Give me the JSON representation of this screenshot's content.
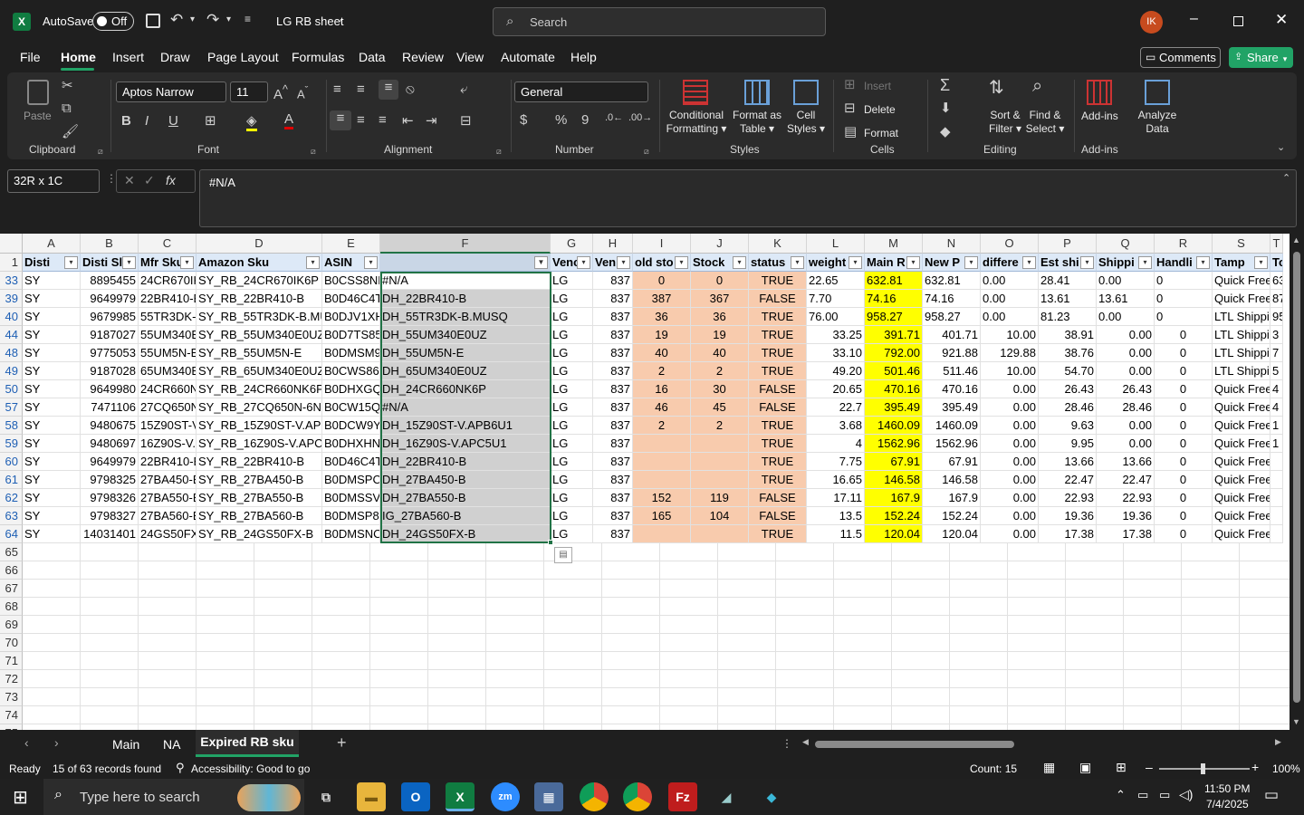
{
  "title_bar": {
    "autosave_label": "AutoSave",
    "autosave_state": "Off",
    "doc_title": "LG RB sheet",
    "search_placeholder": "Search",
    "avatar_initials": "IK"
  },
  "menu": [
    "File",
    "Home",
    "Insert",
    "Draw",
    "Page Layout",
    "Formulas",
    "Data",
    "Review",
    "View",
    "Automate",
    "Help"
  ],
  "menu_right": {
    "comments": "Comments",
    "share": "Share"
  },
  "ribbon": {
    "clipboard": {
      "paste": "Paste",
      "group": "Clipboard"
    },
    "font": {
      "name": "Aptos Narrow",
      "size": "11",
      "group": "Font"
    },
    "alignment": {
      "group": "Alignment"
    },
    "number": {
      "format": "General",
      "group": "Number"
    },
    "styles": {
      "cond1": "Conditional",
      "cond2": "Formatting",
      "fat1": "Format as",
      "fat2": "Table",
      "cs1": "Cell",
      "cs2": "Styles",
      "group": "Styles"
    },
    "cells": {
      "insert": "Insert",
      "delete": "Delete",
      "format": "Format",
      "group": "Cells"
    },
    "editing": {
      "sort1": "Sort &",
      "sort2": "Filter",
      "find1": "Find &",
      "find2": "Select",
      "group": "Editing"
    },
    "addins": {
      "addins": "Add-ins",
      "analyze1": "Analyze",
      "analyze2": "Data",
      "group": "Add-ins"
    }
  },
  "formula_bar": {
    "name_box": "32R x 1C",
    "fx": "fx",
    "formula": "#N/A"
  },
  "columns": [
    {
      "letter": "A",
      "header": "Disti"
    },
    {
      "letter": "B",
      "header": "Disti Sl"
    },
    {
      "letter": "C",
      "header": "Mfr Sku"
    },
    {
      "letter": "D",
      "header": "Amazon Sku"
    },
    {
      "letter": "E",
      "header": "ASIN"
    },
    {
      "letter": "F",
      "header": ""
    },
    {
      "letter": "G",
      "header": "Venc"
    },
    {
      "letter": "H",
      "header": "Ven"
    },
    {
      "letter": "I",
      "header": "old sto"
    },
    {
      "letter": "J",
      "header": "Stock"
    },
    {
      "letter": "K",
      "header": "status"
    },
    {
      "letter": "L",
      "header": "weight"
    },
    {
      "letter": "M",
      "header": "Main R"
    },
    {
      "letter": "N",
      "header": "New P"
    },
    {
      "letter": "O",
      "header": "differe"
    },
    {
      "letter": "P",
      "header": "Est shi"
    },
    {
      "letter": "Q",
      "header": "Shippi"
    },
    {
      "letter": "R",
      "header": "Handli"
    },
    {
      "letter": "S",
      "header": "Tamp"
    },
    {
      "letter": "T",
      "header": "To"
    }
  ],
  "rows": [
    {
      "n": "33",
      "cells": [
        "SY",
        "8895455",
        "24CR670IK",
        "SY_RB_24CR670IK6P",
        "B0CSS8NK",
        "#N/A",
        "LG",
        "837",
        "0",
        "0",
        "TRUE",
        "22.65",
        "632.81",
        "632.81",
        "0.00",
        "28.41",
        "0.00",
        "0",
        "Quick Free",
        "63"
      ]
    },
    {
      "n": "39",
      "cells": [
        "SY",
        "9649979",
        "22BR410-E",
        "SY_RB_22BR410-B",
        "B0D46C4T",
        "DH_22BR410-B",
        "LG",
        "837",
        "387",
        "367",
        "FALSE",
        "7.70",
        "74.16",
        "74.16",
        "0.00",
        "13.61",
        "13.61",
        "0",
        "Quick Free",
        "87"
      ]
    },
    {
      "n": "40",
      "cells": [
        "SY",
        "9679985",
        "55TR3DK-E",
        "SY_RB_55TR3DK-B.MUS",
        "B0DJV1XH",
        "DH_55TR3DK-B.MUSQ",
        "LG",
        "837",
        "36",
        "36",
        "TRUE",
        "76.00",
        "958.27",
        "958.27",
        "0.00",
        "81.23",
        "0.00",
        "0",
        "LTL Shippi",
        "95"
      ]
    },
    {
      "n": "44",
      "cells": [
        "SY",
        "9187027",
        "55UM340E",
        "SY_RB_55UM340E0UZ",
        "B0D7TS85",
        "DH_55UM340E0UZ",
        "LG",
        "837",
        "19",
        "19",
        "TRUE",
        "33.25",
        "391.71",
        "401.71",
        "10.00",
        "38.91",
        "0.00",
        "0",
        "LTL Shippi",
        "3"
      ]
    },
    {
      "n": "48",
      "cells": [
        "SY",
        "9775053",
        "55UM5N-E",
        "SY_RB_55UM5N-E",
        "B0DMSM9",
        "DH_55UM5N-E",
        "LG",
        "837",
        "40",
        "40",
        "TRUE",
        "33.10",
        "792.00",
        "921.88",
        "129.88",
        "38.76",
        "0.00",
        "0",
        "LTL Shippi",
        "7"
      ]
    },
    {
      "n": "49",
      "cells": [
        "SY",
        "9187028",
        "65UM340E",
        "SY_RB_65UM340E0UZ",
        "B0CWS86L",
        "DH_65UM340E0UZ",
        "LG",
        "837",
        "2",
        "2",
        "TRUE",
        "49.20",
        "501.46",
        "511.46",
        "10.00",
        "54.70",
        "0.00",
        "0",
        "LTL Shippi",
        "5"
      ]
    },
    {
      "n": "50",
      "cells": [
        "SY",
        "9649980",
        "24CR660N",
        "SY_RB_24CR660NK6P",
        "B0DHXGQ",
        "DH_24CR660NK6P",
        "LG",
        "837",
        "16",
        "30",
        "FALSE",
        "20.65",
        "470.16",
        "470.16",
        "0.00",
        "26.43",
        "26.43",
        "0",
        "Quick Free",
        "4"
      ]
    },
    {
      "n": "57",
      "cells": [
        "SY",
        "7471106",
        "27CQ650N",
        "SY_RB_27CQ650N-6N",
        "B0CW15Q",
        "#N/A",
        "LG",
        "837",
        "46",
        "45",
        "FALSE",
        "22.7",
        "395.49",
        "395.49",
        "0.00",
        "28.46",
        "28.46",
        "0",
        "Quick Free",
        "4"
      ]
    },
    {
      "n": "58",
      "cells": [
        "SY",
        "9480675",
        "15Z90ST-V",
        "SY_RB_15Z90ST-V.APB6",
        "B0DCW9Y",
        "DH_15Z90ST-V.APB6U1",
        "LG",
        "837",
        "2",
        "2",
        "TRUE",
        "3.68",
        "1460.09",
        "1460.09",
        "0.00",
        "9.63",
        "0.00",
        "0",
        "Quick Free",
        "1"
      ]
    },
    {
      "n": "59",
      "cells": [
        "SY",
        "9480697",
        "16Z90S-V.",
        "SY_RB_16Z90S-V.APC5U",
        "B0DHXHN",
        "DH_16Z90S-V.APC5U1",
        "LG",
        "837",
        "",
        "",
        "TRUE",
        "4",
        "1562.96",
        "1562.96",
        "0.00",
        "9.95",
        "0.00",
        "0",
        "Quick Free",
        "1"
      ]
    },
    {
      "n": "60",
      "cells": [
        "SY",
        "9649979",
        "22BR410-E",
        "SY_RB_22BR410-B",
        "B0D46C4T",
        "DH_22BR410-B",
        "LG",
        "837",
        "",
        "",
        "TRUE",
        "7.75",
        "67.91",
        "67.91",
        "0.00",
        "13.66",
        "13.66",
        "0",
        "Quick Free",
        ""
      ]
    },
    {
      "n": "61",
      "cells": [
        "SY",
        "9798325",
        "27BA450-E",
        "SY_RB_27BA450-B",
        "B0DMSPC",
        "DH_27BA450-B",
        "LG",
        "837",
        "",
        "",
        "TRUE",
        "16.65",
        "146.58",
        "146.58",
        "0.00",
        "22.47",
        "22.47",
        "0",
        "Quick Free",
        ""
      ]
    },
    {
      "n": "62",
      "cells": [
        "SY",
        "9798326",
        "27BA550-E",
        "SY_RB_27BA550-B",
        "B0DMSSVS",
        "DH_27BA550-B",
        "LG",
        "837",
        "152",
        "119",
        "FALSE",
        "17.11",
        "167.9",
        "167.9",
        "0.00",
        "22.93",
        "22.93",
        "0",
        "Quick Free",
        ""
      ]
    },
    {
      "n": "63",
      "cells": [
        "SY",
        "9798327",
        "27BA560-E",
        "SY_RB_27BA560-B",
        "B0DMSP8S",
        "IG_27BA560-B",
        "LG",
        "837",
        "165",
        "104",
        "FALSE",
        "13.5",
        "152.24",
        "152.24",
        "0.00",
        "19.36",
        "19.36",
        "0",
        "Quick Free",
        ""
      ]
    },
    {
      "n": "64",
      "cells": [
        "SY",
        "14031401",
        "24GS50FX",
        "SY_RB_24GS50FX-B",
        "B0DMSNC",
        "DH_24GS50FX-B",
        "LG",
        "837",
        "",
        "",
        "TRUE",
        "11.5",
        "120.04",
        "120.04",
        "0.00",
        "17.38",
        "17.38",
        "0",
        "Quick Free",
        ""
      ]
    }
  ],
  "empty_rows": [
    "65",
    "66",
    "67",
    "68",
    "69",
    "70",
    "71",
    "72",
    "73",
    "74",
    "75"
  ],
  "sheet_tabs": [
    "Main",
    "NA",
    "Expired RB sku"
  ],
  "active_tab": "Expired RB sku",
  "status": {
    "ready": "Ready",
    "records": "15 of 63 records found",
    "accessibility": "Accessibility: Good to go",
    "count": "Count: 15",
    "zoom": "100%"
  },
  "taskbar": {
    "search_placeholder": "Type here to search",
    "time": "11:50 PM",
    "date": "7/4/2025"
  },
  "colors": {
    "accent_green": "#21a366",
    "highlight_yellow": "#ffff00",
    "salmon": "#f8cbad",
    "selection_gray": "#d0d0d0",
    "header_blue": "#dde9f7"
  }
}
